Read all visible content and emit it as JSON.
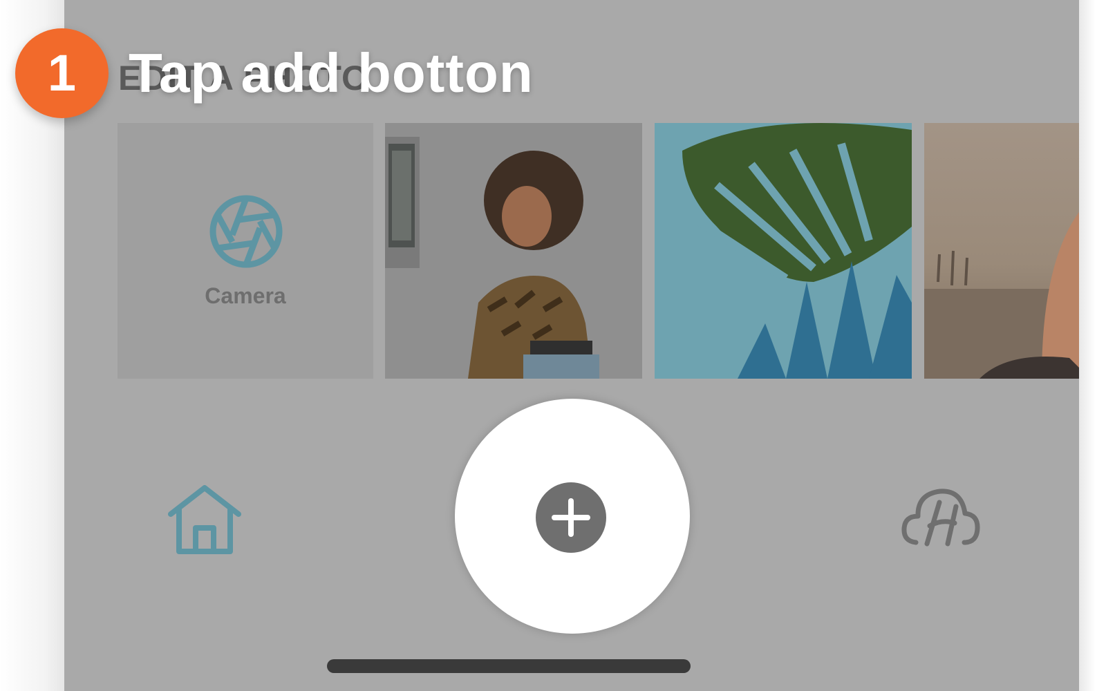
{
  "tutorial": {
    "step_number": "1",
    "instruction": "Tap add botton",
    "badge_color": "#f26a2b"
  },
  "screen": {
    "background_dim_color": "#a9a9a9",
    "section_title": "EDIT A PHOTO",
    "camera_tile": {
      "label": "Camera",
      "icon": "camera-shutter-icon",
      "icon_color": "#5d95a3"
    },
    "photos": [
      {
        "description_icon": "photo-thumbnail"
      },
      {
        "description_icon": "photo-thumbnail"
      },
      {
        "description_icon": "photo-thumbnail"
      }
    ]
  },
  "nav": {
    "home_icon": "home-icon",
    "add_icon": "plus-icon",
    "cloud_icon": "cloud-h-icon",
    "accent_color": "#5d95a3",
    "add_button_color": "#6f6f6f"
  }
}
